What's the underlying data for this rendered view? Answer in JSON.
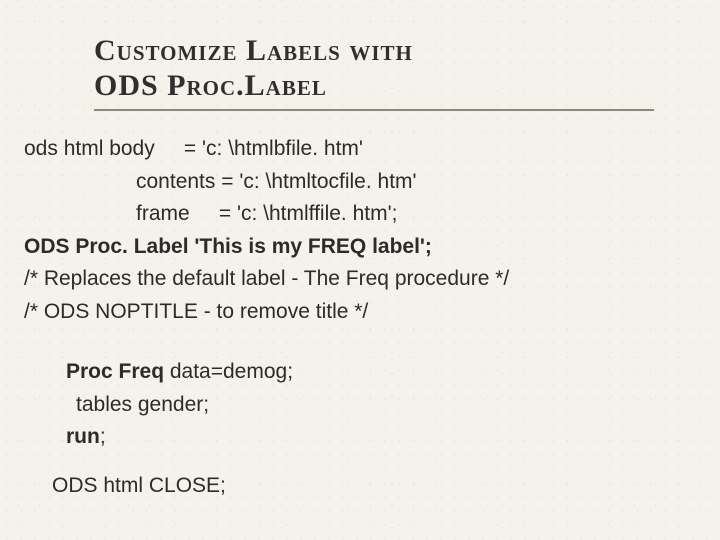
{
  "title_line1": "Customize Labels with",
  "title_line2": "ODS Proc.Label",
  "lines": {
    "l1a": "ods html body     = ",
    "l1b": "'c: \\htmlbfile. htm'",
    "l2": "contents = 'c: \\htmltocfile. htm'",
    "l3": "frame     = 'c: \\htmlffile. htm';",
    "l4": "ODS Proc. Label 'This is my FREQ label';",
    "l5": "/* Replaces the default label - The Freq procedure */",
    "l6": "/* ODS NOPTITLE - to remove title */",
    "l7a": "Proc Freq",
    "l7b": " data=demog;",
    "l8": "tables gender;",
    "l9": "run",
    "l9b": ";",
    "l10": "ODS html CLOSE;"
  }
}
